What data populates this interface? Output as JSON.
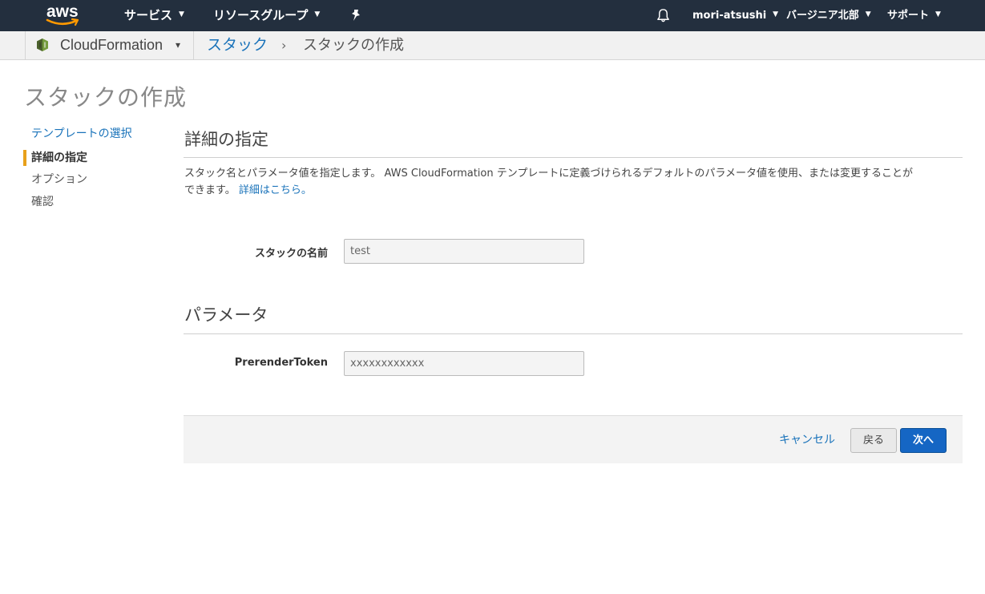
{
  "topnav": {
    "logo_text": "aws",
    "services_label": "サービス",
    "resource_groups_label": "リソースグループ",
    "pin_icon": "pin-icon",
    "bell_icon": "bell-icon",
    "user_label": "mori-atsushi",
    "region_label": "バージニア北部",
    "support_label": "サポート",
    "caret": "▼",
    "bg_color": "#232f3e"
  },
  "subnav": {
    "service_name": "CloudFormation",
    "service_icon": "cloudformation-icon",
    "service_caret": "▾",
    "breadcrumb_link": "スタック",
    "breadcrumb_separator": "›",
    "breadcrumb_current": "スタックの作成"
  },
  "page_title": "スタックの作成",
  "steps": [
    {
      "label": "テンプレートの選択",
      "state": "done"
    },
    {
      "label": "詳細の指定",
      "state": "active"
    },
    {
      "label": "オプション",
      "state": "todo"
    },
    {
      "label": "確認",
      "state": "todo"
    }
  ],
  "details": {
    "heading": "詳細の指定",
    "description_line1": "スタック名とパラメータ値を指定します。 AWS CloudFormation テンプレートに定義づけられるデフォルトのパラメータ値を使用、または変更することが",
    "description_line2": "できます。",
    "learn_more": "詳細はこちら。",
    "stack_name_label": "スタックの名前",
    "stack_name_value": "test"
  },
  "parameters": {
    "heading": "パラメータ",
    "token_label": "PrerenderToken",
    "token_value": "xxxxxxxxxxxx"
  },
  "footer": {
    "cancel_label": "キャンセル",
    "back_label": "戻る",
    "next_label": "次へ"
  },
  "colors": {
    "link": "#1a73ba",
    "accent_marker": "#e8a11b",
    "primary_button": "#1566c4"
  }
}
